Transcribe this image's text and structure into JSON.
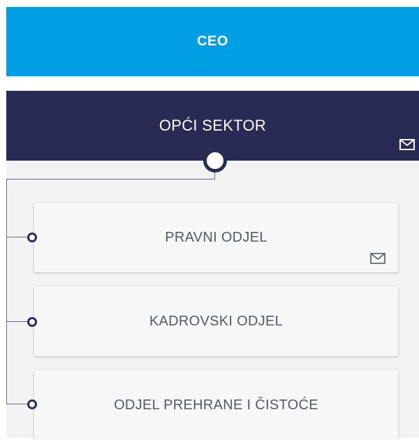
{
  "ceo": {
    "label": "CEO",
    "color": "#009fe3"
  },
  "sector": {
    "label": "OPĆI SEKTOR",
    "color": "#2a2b55",
    "icon": "envelope-icon"
  },
  "departments": [
    {
      "label": "PRAVNI ODJEL",
      "icon": "envelope-icon"
    },
    {
      "label": "KADROVSKI ODJEL"
    },
    {
      "label": "ODJEL PREHRANE I ČISTOĆE"
    }
  ]
}
